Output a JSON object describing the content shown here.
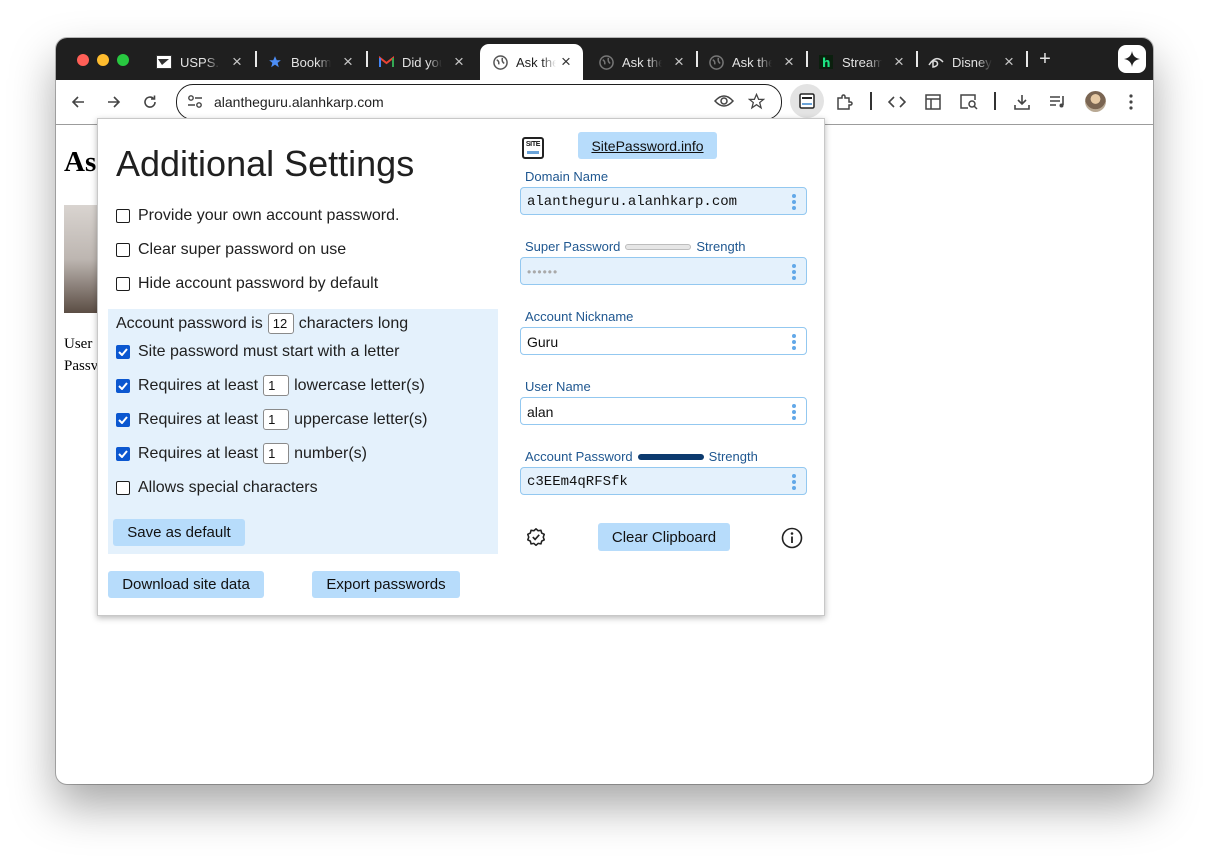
{
  "browser": {
    "tabs": [
      {
        "title": "USPS.c",
        "icon": "usps-eagle-icon"
      },
      {
        "title": "Bookm",
        "icon": "star-icon"
      },
      {
        "title": "Did you",
        "icon": "gmail-icon"
      },
      {
        "title": "Ask the",
        "icon": "globe-icon",
        "active": true
      },
      {
        "title": "Ask the",
        "icon": "globe-icon"
      },
      {
        "title": "Ask the",
        "icon": "globe-icon"
      },
      {
        "title": "Stream",
        "icon": "hulu-icon"
      },
      {
        "title": "Disney",
        "icon": "disney-icon"
      }
    ],
    "url": "alantheguru.alanhkarp.com"
  },
  "page": {
    "heading": "As",
    "line1": "User",
    "line2": "Passv"
  },
  "popup": {
    "title": "Additional Settings",
    "options": {
      "own_password": "Provide your own account password.",
      "clear_super": "Clear super password on use",
      "hide_password": "Hide account password by default"
    },
    "rules": {
      "length_prefix": "Account password is",
      "length_value": "12",
      "length_suffix": "characters long",
      "start_letter": "Site password must start with a letter",
      "requires_prefix": "Requires at least",
      "lower_count": "1",
      "lower_suffix": "lowercase letter(s)",
      "upper_count": "1",
      "upper_suffix": "uppercase letter(s)",
      "number_count": "1",
      "number_suffix": "number(s)",
      "special": "Allows special characters",
      "save_default": "Save as default"
    },
    "download_button": "Download site data",
    "export_button": "Export passwords",
    "logo_text": "SITE",
    "site_link": "SitePassword.info",
    "fields": {
      "domain_label": "Domain Name",
      "domain_value": "alantheguru.alanhkarp.com",
      "super_label": "Super Password",
      "super_value": "••••••",
      "strength_label": "Strength",
      "nickname_label": "Account Nickname",
      "nickname_value": "Guru",
      "username_label": "User Name",
      "username_value": "alan",
      "account_pw_label": "Account Password",
      "account_pw_value": "c3EEm4qRFSfk"
    },
    "clear_clipboard": "Clear Clipboard"
  },
  "colors": {
    "accent_button": "#b7dcfb",
    "settings_panel": "#e4f1fc",
    "label_blue": "#1f5790",
    "checkbox_blue": "#0b57d0",
    "strength_strong": "#0c3a6e"
  }
}
